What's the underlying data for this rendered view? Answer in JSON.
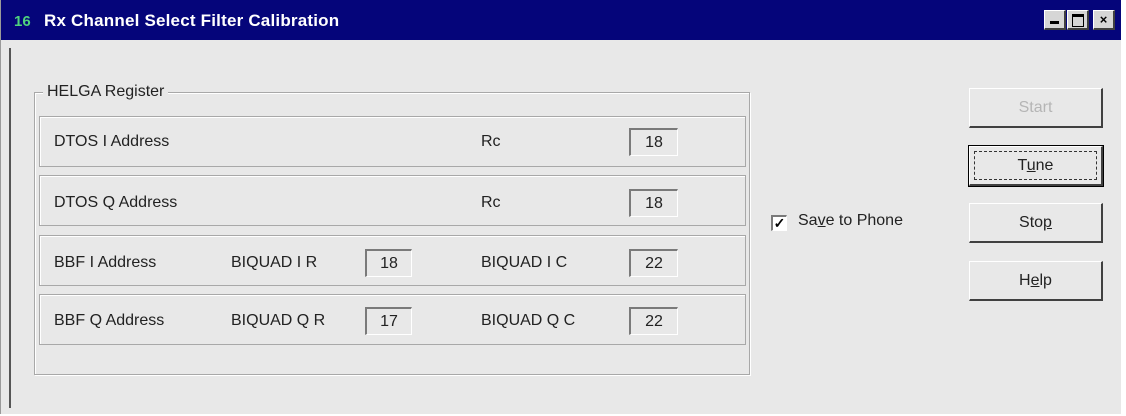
{
  "window": {
    "title": "Rx Channel Select Filter Calibration",
    "icon_text": "16",
    "controls": {
      "minimize": "minimize-icon",
      "maximize": "maximize-icon",
      "close": "×"
    }
  },
  "group": {
    "label": "HELGA Register",
    "rows": [
      {
        "address": "DTOS I Address",
        "fields": [
          {
            "label": "Rc",
            "value": "18"
          }
        ]
      },
      {
        "address": "DTOS Q Address",
        "fields": [
          {
            "label": "Rc",
            "value": "18"
          }
        ]
      },
      {
        "address": "BBF I Address",
        "fields": [
          {
            "label": "BIQUAD I R",
            "value": "18"
          },
          {
            "label": "BIQUAD I C",
            "value": "22"
          }
        ]
      },
      {
        "address": "BBF Q Address",
        "fields": [
          {
            "label": "BIQUAD Q R",
            "value": "17"
          },
          {
            "label": "BIQUAD Q C",
            "value": "22"
          }
        ]
      }
    ]
  },
  "checkbox": {
    "checked": true,
    "mark": "✓",
    "label_pre": "Sa",
    "label_ul": "v",
    "label_post": "e to Phone"
  },
  "buttons": {
    "start": {
      "label": "Start",
      "disabled": true
    },
    "tune": {
      "pre": "T",
      "ul": "u",
      "post": "ne"
    },
    "stop": {
      "pre": "Sto",
      "ul": "p",
      "post": ""
    },
    "help": {
      "pre": "H",
      "ul": "e",
      "post": "lp"
    }
  }
}
